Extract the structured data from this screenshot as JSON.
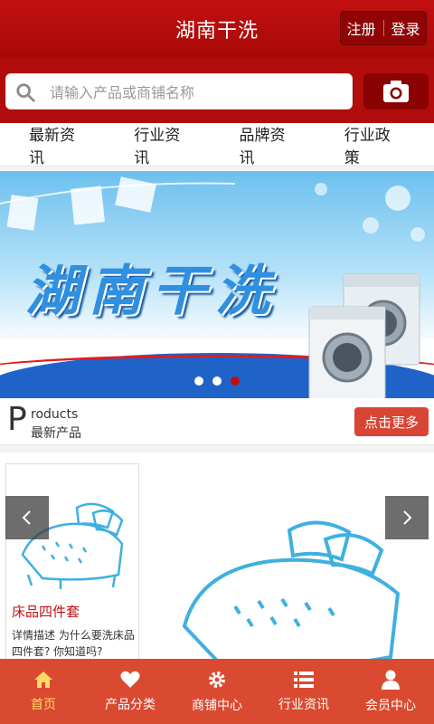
{
  "header": {
    "title": "湖南干洗",
    "register": "注册",
    "login": "登录"
  },
  "search": {
    "placeholder": "请输入产品或商铺名称"
  },
  "nav": [
    {
      "label": "最新资讯"
    },
    {
      "label": "行业资讯"
    },
    {
      "label": "品牌资讯"
    },
    {
      "label": "行业政策"
    }
  ],
  "banner": {
    "headline": "湖南干洗",
    "carousel": {
      "total": 3,
      "active_index": 3
    }
  },
  "products": {
    "initial": "P",
    "english": "roducts",
    "chinese": "最新产品",
    "more": "点击更多",
    "items": [
      {
        "name": "床品四件套",
        "description": "详情描述 为什么要洗床品四件套? 你知道吗?"
      }
    ]
  },
  "tabbar": [
    {
      "label": "首页",
      "icon": "home-icon",
      "active": true
    },
    {
      "label": "产品分类",
      "icon": "heart-icon",
      "active": false
    },
    {
      "label": "商铺中心",
      "icon": "gear-icon",
      "active": false
    },
    {
      "label": "行业资讯",
      "icon": "list-icon",
      "active": false
    },
    {
      "label": "会员中心",
      "icon": "user-icon",
      "active": false
    }
  ],
  "colors": {
    "primary": "#b20c0c",
    "tabbar": "#d94a30",
    "active_tab": "#ffd966",
    "accent_button": "#d94534"
  }
}
